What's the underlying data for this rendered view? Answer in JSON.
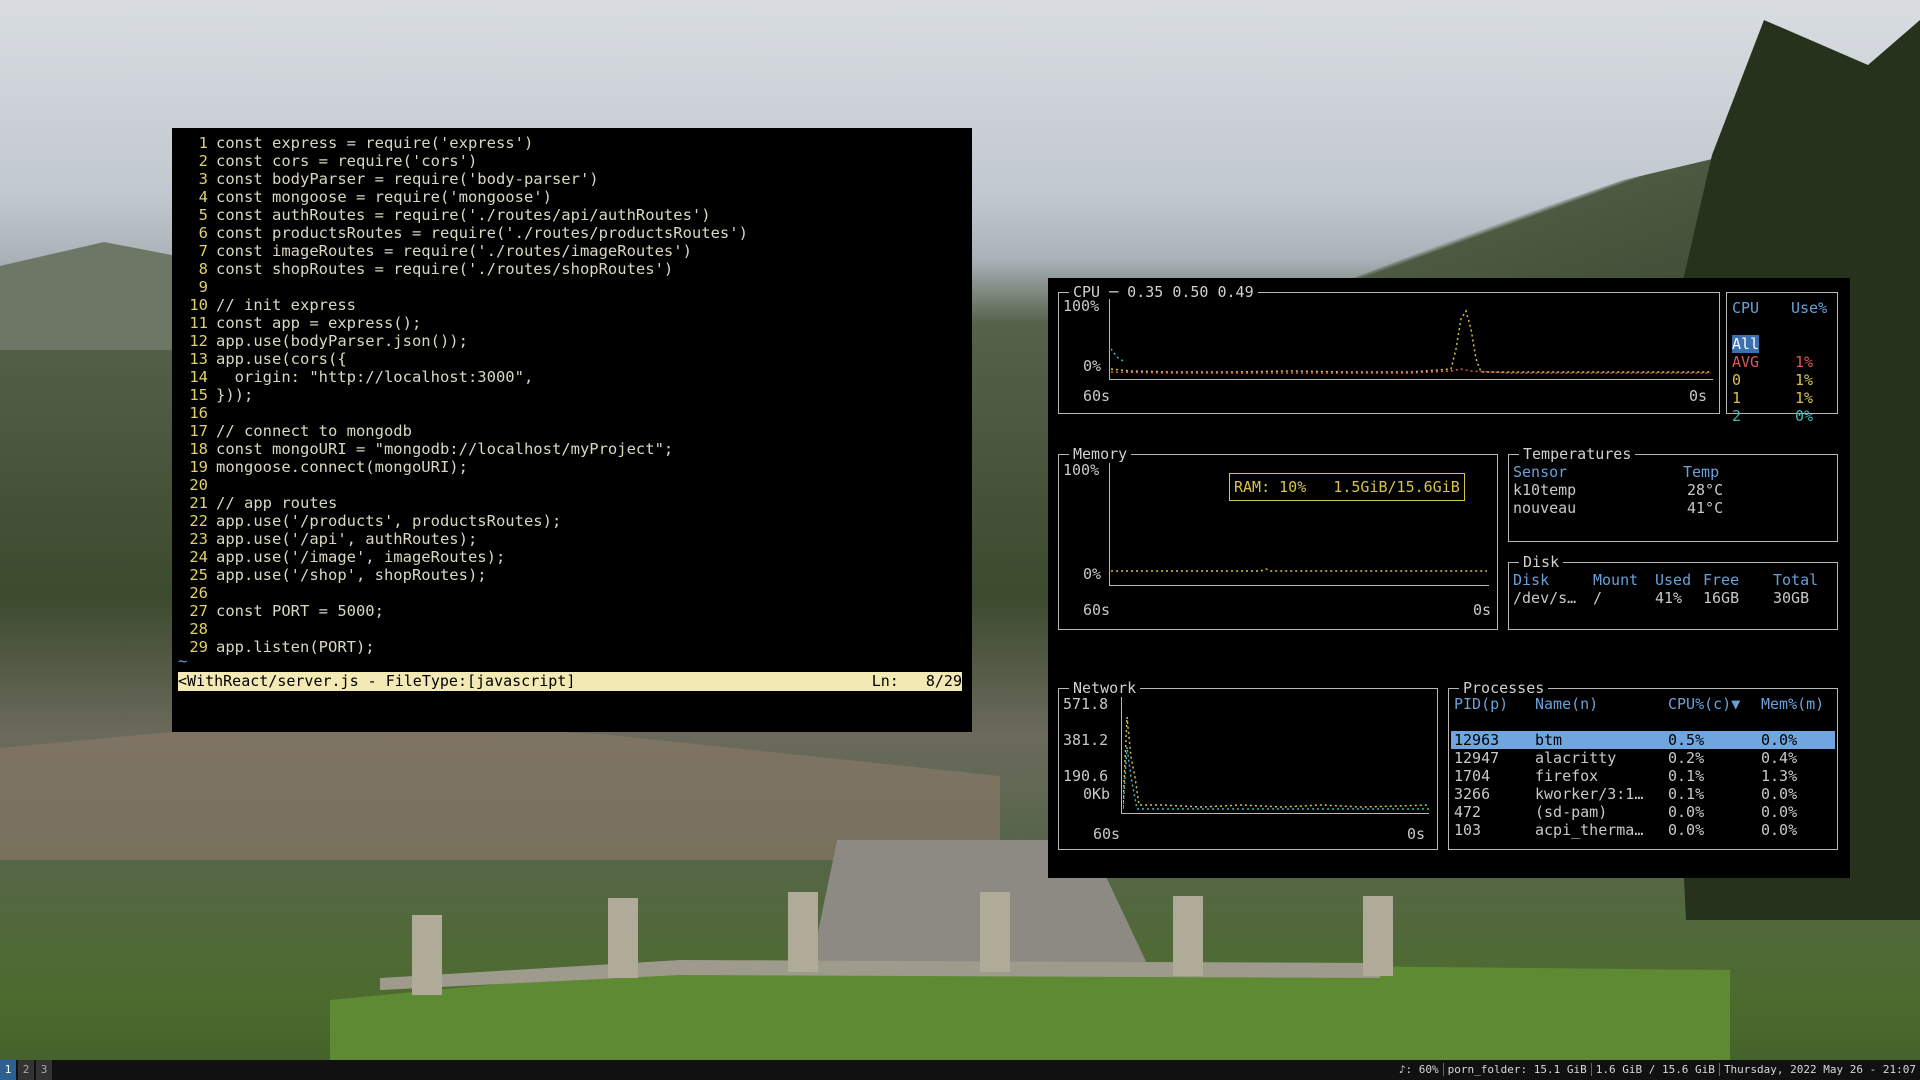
{
  "editor": {
    "lines": [
      {
        "n": "1",
        "text": "const express = require('express')"
      },
      {
        "n": "2",
        "text": "const cors = require('cors')"
      },
      {
        "n": "3",
        "text": "const bodyParser = require('body-parser')"
      },
      {
        "n": "4",
        "text": "const mongoose = require('mongoose')"
      },
      {
        "n": "5",
        "text": "const authRoutes = require('./routes/api/authRoutes')"
      },
      {
        "n": "6",
        "text": "const productsRoutes = require('./routes/productsRoutes')"
      },
      {
        "n": "7",
        "text": "const imageRoutes = require('./routes/imageRoutes')"
      },
      {
        "n": "8",
        "text": "const shopRoutes = require('./routes/shopRoutes')"
      },
      {
        "n": "9",
        "text": ""
      },
      {
        "n": "10",
        "text": "// init express"
      },
      {
        "n": "11",
        "text": "const app = express();"
      },
      {
        "n": "12",
        "text": "app.use(bodyParser.json());"
      },
      {
        "n": "13",
        "text": "app.use(cors({"
      },
      {
        "n": "14",
        "text": "  origin: \"http://localhost:3000\","
      },
      {
        "n": "15",
        "text": "}));"
      },
      {
        "n": "16",
        "text": ""
      },
      {
        "n": "17",
        "text": "// connect to mongodb"
      },
      {
        "n": "18",
        "text": "const mongoURI = \"mongodb://localhost/myProject\";"
      },
      {
        "n": "19",
        "text": "mongoose.connect(mongoURI);"
      },
      {
        "n": "20",
        "text": ""
      },
      {
        "n": "21",
        "text": "// app routes"
      },
      {
        "n": "22",
        "text": "app.use('/products', productsRoutes);"
      },
      {
        "n": "23",
        "text": "app.use('/api', authRoutes);"
      },
      {
        "n": "24",
        "text": "app.use('/image', imageRoutes);"
      },
      {
        "n": "25",
        "text": "app.use('/shop', shopRoutes);"
      },
      {
        "n": "26",
        "text": ""
      },
      {
        "n": "27",
        "text": "const PORT = 5000;"
      },
      {
        "n": "28",
        "text": ""
      },
      {
        "n": "29",
        "text": "app.listen(PORT);"
      }
    ],
    "tilde": "~",
    "status_left": "<WithReact/server.js - FileType:[javascript]",
    "status_right": "Ln:   8/29"
  },
  "btm": {
    "cpu": {
      "title": "CPU ─ 0.35 0.50 0.49",
      "y_top": "100%",
      "y_bottom": "0%",
      "x_left": "60s",
      "x_right": "0s",
      "legend_header_cpu": "CPU",
      "legend_header_use": "Use%",
      "rows": [
        {
          "name": "All",
          "value": ""
        },
        {
          "name": "AVG",
          "value": "1%"
        },
        {
          "name": "0",
          "value": "1%"
        },
        {
          "name": "1",
          "value": "1%"
        },
        {
          "name": "2",
          "value": "0%"
        }
      ]
    },
    "memory": {
      "title": "Memory",
      "y_top": "100%",
      "y_bottom": "0%",
      "x_left": "60s",
      "x_right": "0s",
      "ram_label": "RAM: 10%   1.5GiB/15.6GiB"
    },
    "temperatures": {
      "title": "Temperatures",
      "headers": [
        "Sensor",
        "Temp"
      ],
      "rows": [
        [
          "k10temp",
          "28°C"
        ],
        [
          "nouveau",
          "41°C"
        ]
      ]
    },
    "disk": {
      "title": "Disk",
      "headers": [
        "Disk",
        "Mount",
        "Used",
        "Free",
        "Total"
      ],
      "rows": [
        [
          "/dev/s…",
          "/",
          "41%",
          "16GB",
          "30GB"
        ]
      ]
    },
    "network": {
      "title": "Network",
      "y_labels": [
        "571.8",
        "381.2",
        "190.6",
        "0Kb"
      ],
      "x_left": "60s",
      "x_right": "0s"
    },
    "processes": {
      "title": "Processes",
      "headers": [
        "PID(p)",
        "Name(n)",
        "CPU%(c)▼",
        "Mem%(m)"
      ],
      "rows": [
        [
          "12963",
          "btm",
          "0.5%",
          "0.0%"
        ],
        [
          "12947",
          "alacritty",
          "0.2%",
          "0.4%"
        ],
        [
          "1704",
          "firefox",
          "0.1%",
          "1.3%"
        ],
        [
          "3266",
          "kworker/3:1…",
          "0.1%",
          "0.0%"
        ],
        [
          "472",
          "(sd-pam)",
          "0.0%",
          "0.0%"
        ],
        [
          "103",
          "acpi_therma…",
          "0.0%",
          "0.0%"
        ]
      ]
    }
  },
  "taskbar": {
    "workspaces": [
      "1",
      "2",
      "3"
    ],
    "status": [
      "♪: 60%",
      "porn_folder: 15.1 GiB",
      "1.6 GiB / 15.6 GiB",
      "Thursday, 2022 May 26 - 21:07"
    ]
  },
  "colors": {
    "accent": "#6fa6e0",
    "editor_numbers": "#e0d16a",
    "statusbar": "#f3e9b4"
  }
}
